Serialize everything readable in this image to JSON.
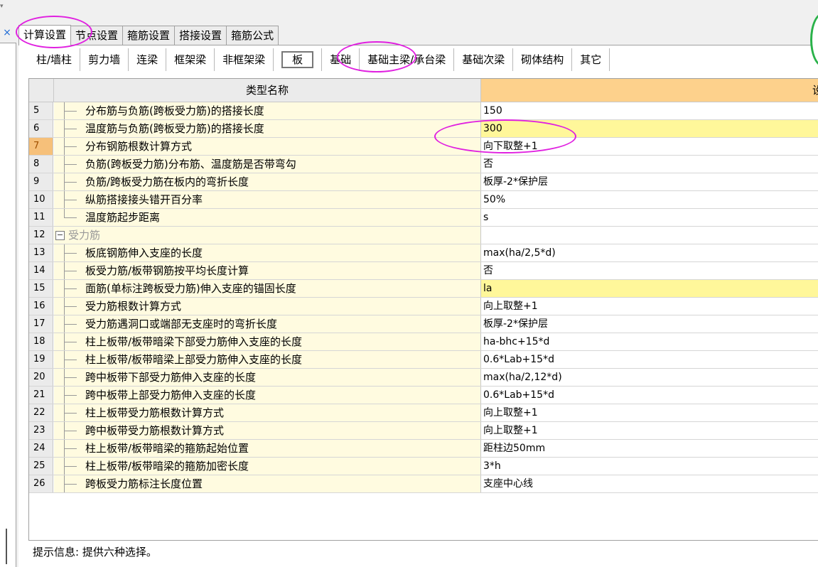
{
  "window": {
    "close_glyph": "×",
    "arrow_glyph": "▾"
  },
  "top_tabs": [
    {
      "label": "计算设置",
      "active": true
    },
    {
      "label": "节点设置",
      "active": false
    },
    {
      "label": "箍筋设置",
      "active": false
    },
    {
      "label": "搭接设置",
      "active": false
    },
    {
      "label": "箍筋公式",
      "active": false
    }
  ],
  "category_tabs": [
    {
      "label": "柱/墙柱",
      "active": false
    },
    {
      "label": "剪力墙",
      "active": false
    },
    {
      "label": "连梁",
      "active": false
    },
    {
      "label": "框架梁",
      "active": false
    },
    {
      "label": "非框架梁",
      "active": false
    },
    {
      "label": "板",
      "active": true
    },
    {
      "label": "基础",
      "active": false
    },
    {
      "label": "基础主梁/承台梁",
      "active": false
    },
    {
      "label": "基础次梁",
      "active": false
    },
    {
      "label": "砌体结构",
      "active": false
    },
    {
      "label": "其它",
      "active": false
    }
  ],
  "grid": {
    "header_name": "类型名称",
    "header_value_partial": "设",
    "rows": [
      {
        "num": "5",
        "name": "分布筋与负筋(跨板受力筋)的搭接长度",
        "value": "150"
      },
      {
        "num": "6",
        "name": "温度筋与负筋(跨板受力筋)的搭接长度",
        "value": "300",
        "highlight": true
      },
      {
        "num": "7",
        "name": "分布钢筋根数计算方式",
        "value": "向下取整+1",
        "selected": true
      },
      {
        "num": "8",
        "name": "负筋(跨板受力筋)分布筋、温度筋是否带弯勾",
        "value": "否"
      },
      {
        "num": "9",
        "name": "负筋/跨板受力筋在板内的弯折长度",
        "value": "板厚-2*保护层"
      },
      {
        "num": "10",
        "name": "纵筋搭接接头错开百分率",
        "value": "50%"
      },
      {
        "num": "11",
        "name": "温度筋起步距离",
        "value": "s",
        "last_in_group": true
      },
      {
        "num": "12",
        "name": "受力筋",
        "value": "",
        "group": true,
        "expander": "−"
      },
      {
        "num": "13",
        "name": "板底钢筋伸入支座的长度",
        "value": "max(ha/2,5*d)"
      },
      {
        "num": "14",
        "name": "板受力筋/板带钢筋按平均长度计算",
        "value": "否"
      },
      {
        "num": "15",
        "name": "面筋(单标注跨板受力筋)伸入支座的锚固长度",
        "value": "la",
        "highlight": true
      },
      {
        "num": "16",
        "name": "受力筋根数计算方式",
        "value": "向上取整+1"
      },
      {
        "num": "17",
        "name": "受力筋遇洞口或端部无支座时的弯折长度",
        "value": "板厚-2*保护层"
      },
      {
        "num": "18",
        "name": "柱上板带/板带暗梁下部受力筋伸入支座的长度",
        "value": "ha-bhc+15*d"
      },
      {
        "num": "19",
        "name": "柱上板带/板带暗梁上部受力筋伸入支座的长度",
        "value": "0.6*Lab+15*d"
      },
      {
        "num": "20",
        "name": "跨中板带下部受力筋伸入支座的长度",
        "value": "max(ha/2,12*d)"
      },
      {
        "num": "21",
        "name": "跨中板带上部受力筋伸入支座的长度",
        "value": "0.6*Lab+15*d"
      },
      {
        "num": "22",
        "name": "柱上板带受力筋根数计算方式",
        "value": "向上取整+1"
      },
      {
        "num": "23",
        "name": "跨中板带受力筋根数计算方式",
        "value": "向上取整+1"
      },
      {
        "num": "24",
        "name": "柱上板带/板带暗梁的箍筋起始位置",
        "value": "距柱边50mm"
      },
      {
        "num": "25",
        "name": "柱上板带/板带暗梁的箍筋加密长度",
        "value": "3*h"
      },
      {
        "num": "26",
        "name": "跨板受力筋标注长度位置",
        "value": "支座中心线"
      }
    ]
  },
  "status": {
    "text": "提示信息: 提供六种选择。"
  },
  "annotation_color": "#e020e0"
}
